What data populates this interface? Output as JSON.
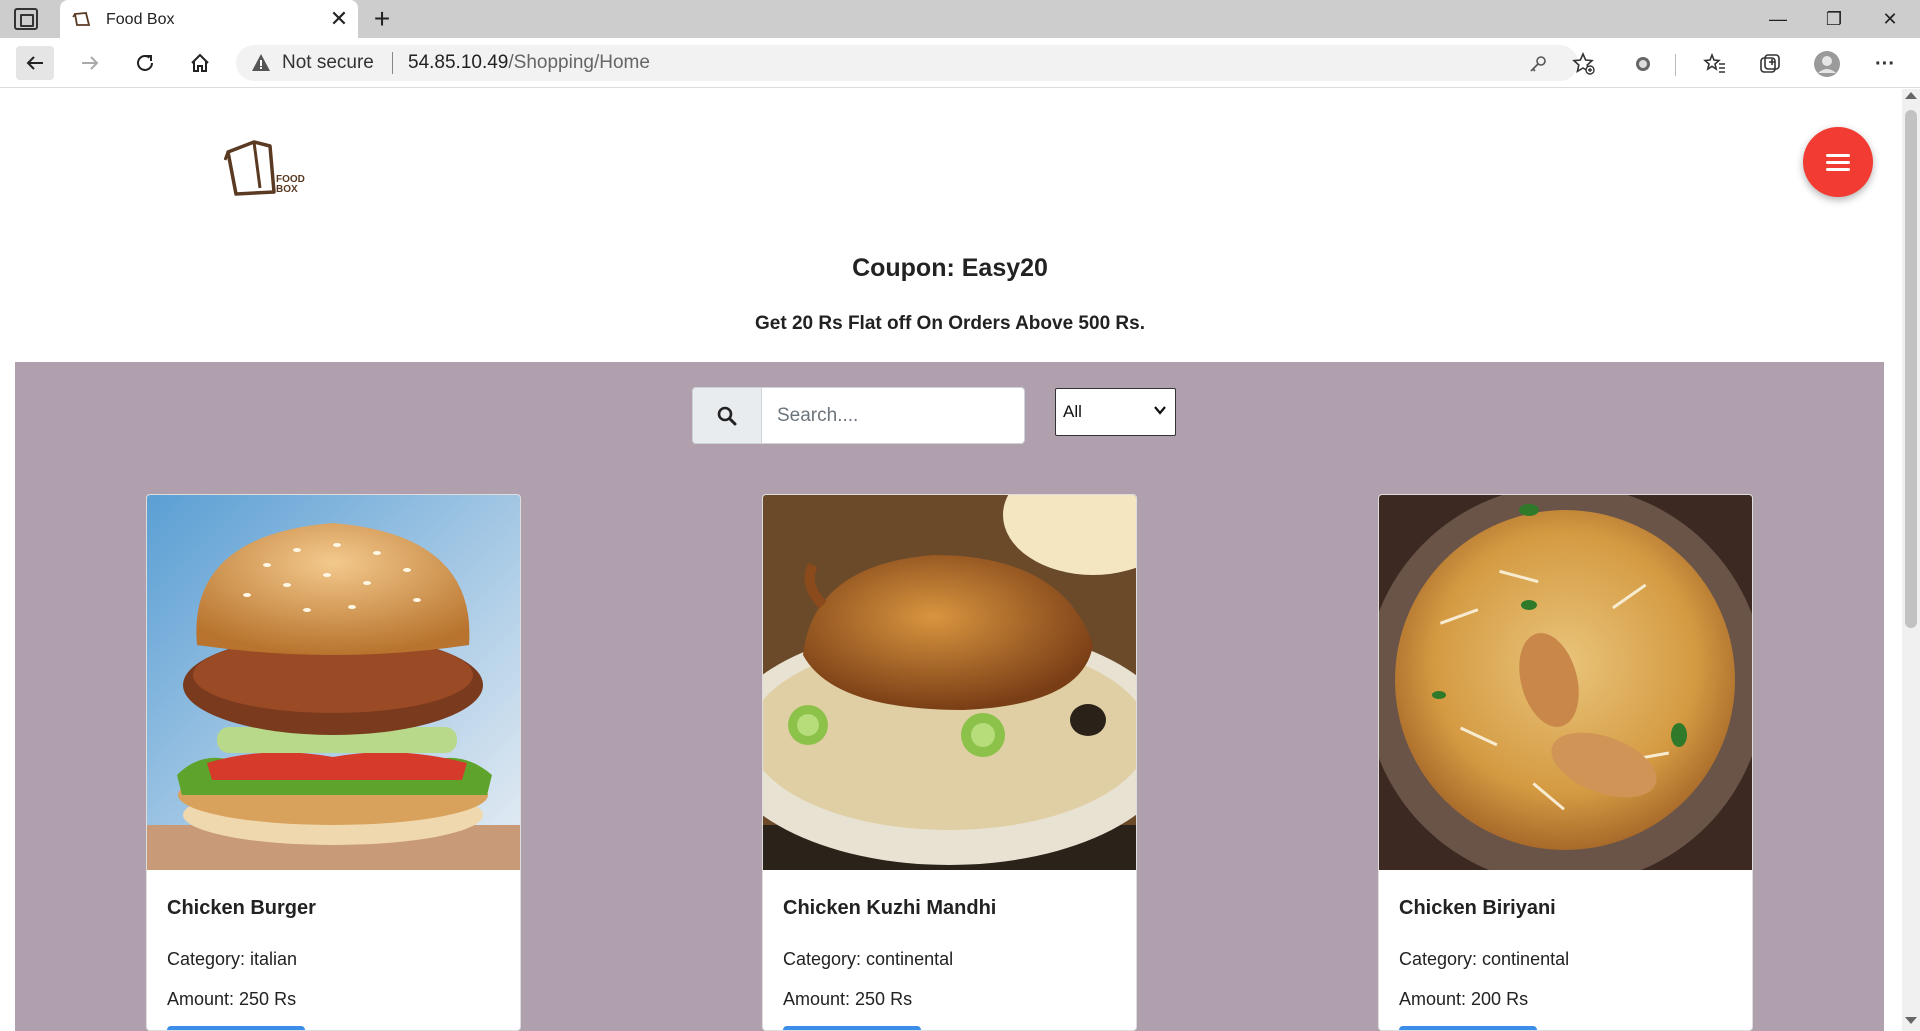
{
  "browser": {
    "tab_title": "Food Box",
    "tab_close": "✕",
    "new_tab": "+",
    "address_security": "Not secure",
    "url_host": "54.85.10.49",
    "url_path": "/Shopping/Home",
    "window_minimize": "—",
    "window_restore": "❐",
    "window_close": "✕",
    "more_menu": "···"
  },
  "header": {
    "logo_alt": "FOOD BOX",
    "logo_text_top": "FOOD",
    "logo_text_bottom": "BOX"
  },
  "promo": {
    "title": "Coupon: Easy20",
    "description": "Get 20 Rs Flat off On Orders Above 500 Rs."
  },
  "filters": {
    "search_placeholder": "Search....",
    "search_value": "",
    "category_selected": "All"
  },
  "products": [
    {
      "name": "Chicken Burger",
      "category": "Category: italian",
      "amount": "Amount: 250 Rs"
    },
    {
      "name": "Chicken Kuzhi Mandhi",
      "category": "Category: continental",
      "amount": "Amount: 250 Rs"
    },
    {
      "name": "Chicken Biriyani",
      "category": "Category: continental",
      "amount": "Amount: 200 Rs"
    }
  ],
  "colors": {
    "panel_bg": "#b09fad",
    "fab": "#f23b33",
    "button_blue": "#3b8ee8"
  }
}
